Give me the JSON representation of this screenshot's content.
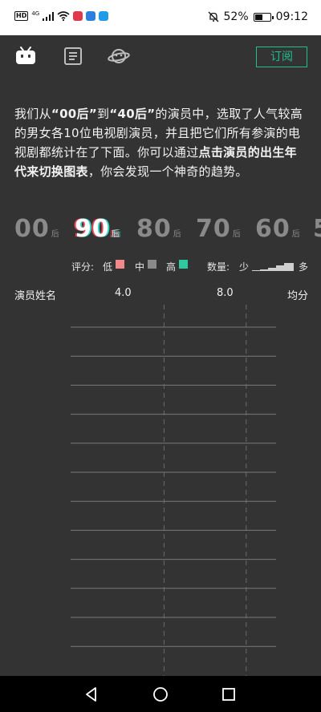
{
  "status_bar": {
    "network": "4G",
    "battery_percent": "52%",
    "battery_level": 0.52,
    "time": "09:12"
  },
  "toolbar": {
    "icons": [
      "bilibili-tv-icon",
      "article-icon",
      "planet-icon"
    ],
    "subscribe_label": "订阅"
  },
  "intro": {
    "part1": "我们从",
    "q1": "“00后”",
    "part2": "到",
    "q2": "“40后”",
    "part3": "的演员中，选取了人气较高的男女各10位电视剧演员，并且把它们所有参演的电视剧都统计在了下面。你可以通过",
    "bold": "点击演员的出生年代来切换图表",
    "part4": "，你会发现一个神奇的趋势。"
  },
  "decades": [
    {
      "label": "00",
      "suffix": "后",
      "active": false
    },
    {
      "label": "90",
      "suffix": "后",
      "active": true
    },
    {
      "label": "80",
      "suffix": "后",
      "active": false
    },
    {
      "label": "70",
      "suffix": "后",
      "active": false
    },
    {
      "label": "60",
      "suffix": "后",
      "active": false
    },
    {
      "label": "5",
      "suffix": "",
      "active": false
    }
  ],
  "legend": {
    "score_label": "评分:",
    "low": "低",
    "mid": "中",
    "high": "高",
    "low_color": "#f08a8a",
    "mid_color": "#8a8a8a",
    "high_color": "#2fc9a0",
    "qty_label": "数量:",
    "few": "少",
    "many": "多"
  },
  "table_header": {
    "name_col": "演员姓名",
    "tick1": "4.0",
    "tick2": "8.0",
    "avg_col": "均分"
  },
  "chart_data": {
    "type": "table",
    "rows": 12,
    "x_ticks": [
      "4.0",
      "8.0"
    ],
    "values": []
  }
}
